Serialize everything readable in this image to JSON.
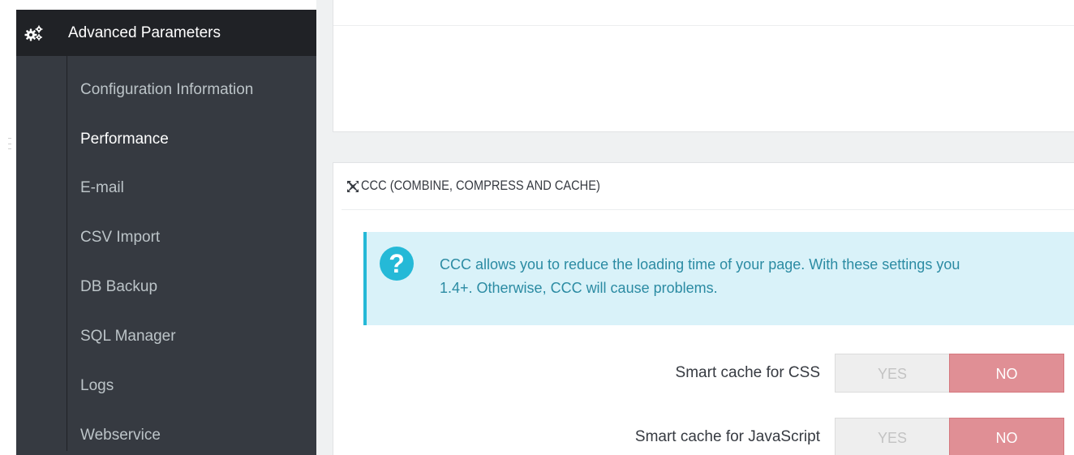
{
  "sidebar": {
    "header": {
      "icon": "cogs-icon",
      "label": "Advanced Parameters"
    },
    "items": [
      {
        "label": "Configuration Information",
        "active": false
      },
      {
        "label": "Performance",
        "active": true
      },
      {
        "label": "E-mail",
        "active": false
      },
      {
        "label": "CSV Import",
        "active": false
      },
      {
        "label": "DB Backup",
        "active": false
      },
      {
        "label": "SQL Manager",
        "active": false
      },
      {
        "label": "Logs",
        "active": false
      },
      {
        "label": "Webservice",
        "active": false
      }
    ]
  },
  "ccc_panel": {
    "icon": "arrows-compress-icon",
    "title": "CCC (COMBINE, COMPRESS AND CACHE)",
    "alert": {
      "icon": "question-circle-icon",
      "line1": "CCC allows you to reduce the loading time of your page. With these settings you",
      "line2": "1.4+. Otherwise, CCC will cause problems."
    },
    "fields": [
      {
        "label": "Smart cache for CSS",
        "yes": "YES",
        "no": "NO",
        "selected": "NO"
      },
      {
        "label": "Smart cache for JavaScript",
        "yes": "YES",
        "no": "NO",
        "selected": "NO"
      }
    ]
  },
  "colors": {
    "sidebar_bg": "#363a41",
    "sidebar_header_bg": "#202226",
    "alert_bg": "#d9f2f9",
    "alert_accent": "#25b9d7",
    "switch_no_active": "#e08f95"
  }
}
